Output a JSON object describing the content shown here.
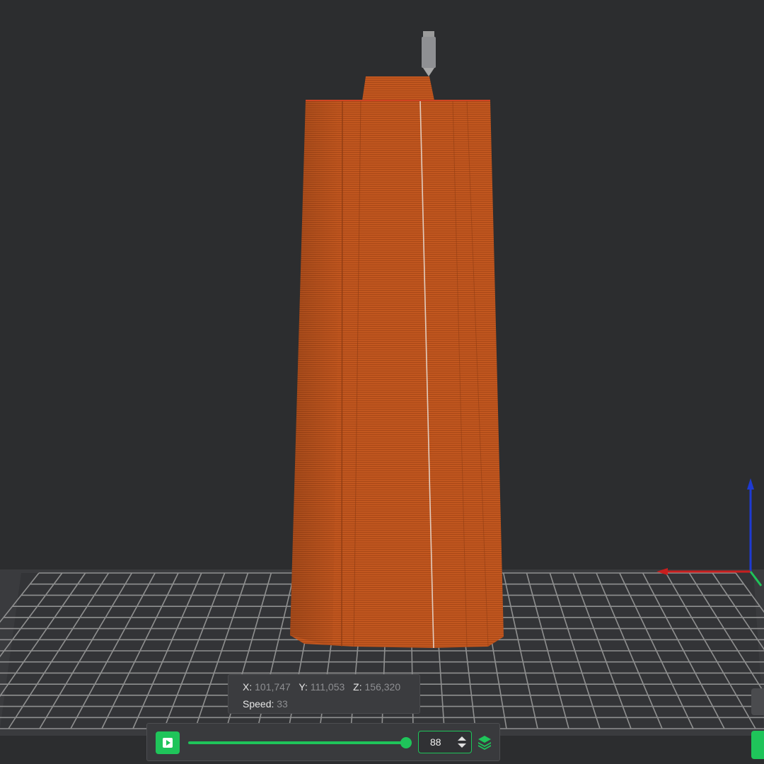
{
  "viewport": {
    "model_color": "#c2571f",
    "bed_grid_color": "#9a9a9a",
    "accent": "#1fc45a"
  },
  "position_info": {
    "x_label": "X:",
    "x_value": "101,747",
    "y_label": "Y:",
    "y_value": "111,053",
    "z_label": "Z:",
    "z_value": "156,320",
    "speed_label": "Speed:",
    "speed_value": "33"
  },
  "playback": {
    "play_icon": "play-icon",
    "progress": 1.0,
    "layer_value": "88",
    "layers_icon": "layers-icon"
  },
  "axes": {
    "x_color": "#c81e1e",
    "y_color": "#1fc45a",
    "z_color": "#1e3ad2"
  }
}
